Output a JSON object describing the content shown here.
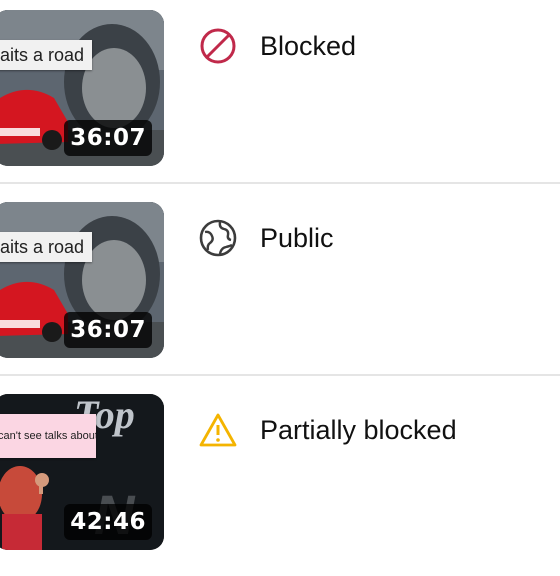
{
  "rows": [
    {
      "thumbnail": {
        "caption": "aits a road",
        "duration": "36:07"
      },
      "visibility": {
        "label": "Blocked",
        "icon": "blocked-icon",
        "color": "#c0294a"
      }
    },
    {
      "thumbnail": {
        "caption": "aits a road",
        "duration": "36:07"
      },
      "visibility": {
        "label": "Public",
        "icon": "globe-icon",
        "color": "#3c3c3c"
      }
    },
    {
      "thumbnail": {
        "caption": "can't see talks about.",
        "duration": "42:46"
      },
      "visibility": {
        "label": "Partially blocked",
        "icon": "warning-icon",
        "color": "#f4b400"
      }
    }
  ]
}
